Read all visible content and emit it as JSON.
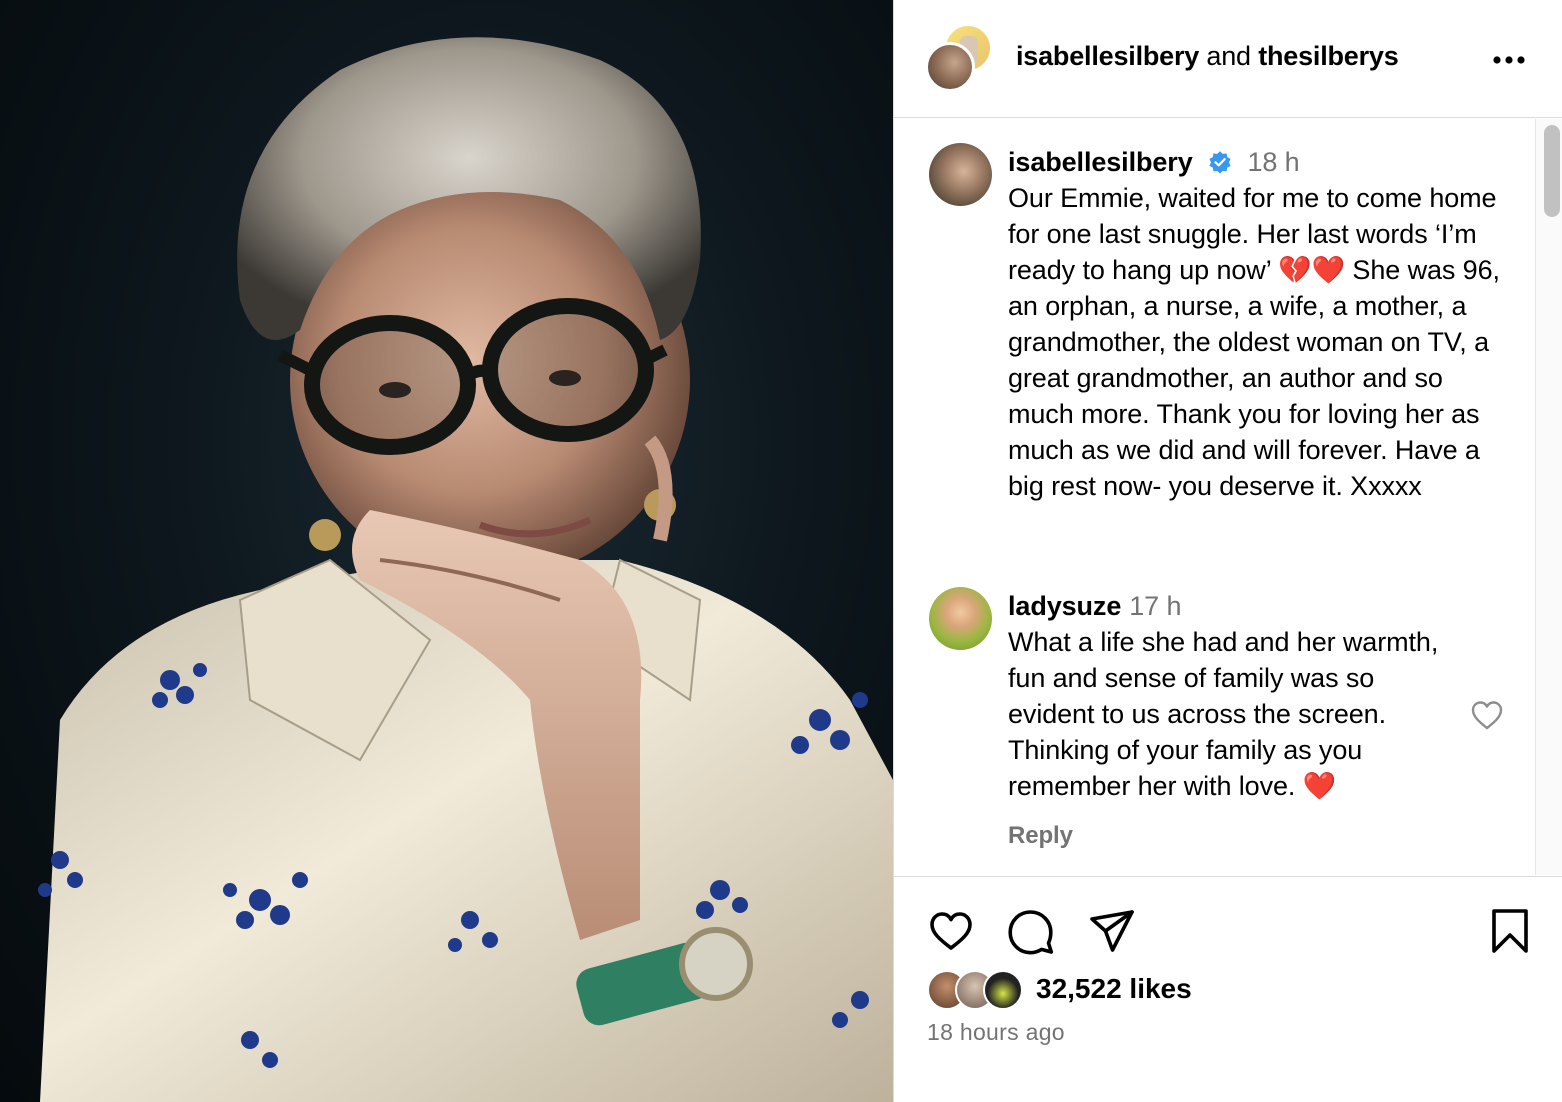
{
  "post": {
    "header": {
      "author1": "isabellesilbery",
      "joiner": " and ",
      "author2": "thesilberys"
    },
    "caption": {
      "username": "isabellesilbery",
      "time": "18 h",
      "text": "Our Emmie, waited for me to come home for one last snuggle. Her last words ‘I’m ready to hang up now’ 💔❤️ She was 96, an orphan, a nurse, a wife, a mother, a grandmother, the oldest woman on TV, a great grandmother, an author and so much more. Thank you for loving her as much as we did and will forever. Have a big rest now- you deserve it. Xxxxx"
    },
    "comments": [
      {
        "username": "ladysuze",
        "time": "17 h",
        "text": "What a life she had and her warmth, fun and sense of family was so evident to us across the screen. Thinking of your family as you remember her with love. ❤️",
        "reply_label": "Reply"
      }
    ],
    "likes_count": "32,522 likes",
    "posted_ago": "18 hours ago"
  },
  "icons": [
    "more-icon",
    "verified-badge-icon",
    "heart-icon",
    "comment-icon",
    "share-icon",
    "bookmark-icon"
  ],
  "colors": {
    "verified": "#3897f0",
    "muted_text": "#737373",
    "divider": "#dbdbdb"
  }
}
